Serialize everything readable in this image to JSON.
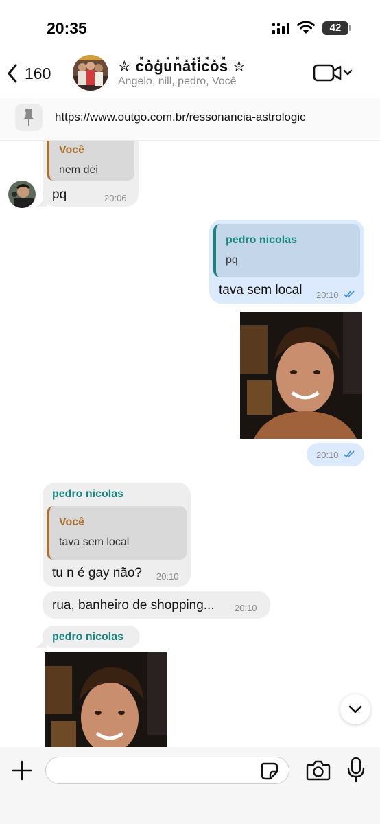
{
  "status_bar": {
    "time": "20:35",
    "battery": "42"
  },
  "header": {
    "back_count": "160",
    "group_title": "✮ c̽o̽g̽u̽n̽a̽t̽i̽c̽o̽s̽ ✮",
    "members": "Angelo, nill, pedro, Você"
  },
  "pinned": {
    "link": "https://www.outgo.com.br/ressonancia-astrologic"
  },
  "messages": {
    "m1": {
      "quote_author": "Você",
      "quote_text": "nem dei",
      "text": "pq",
      "time": "20:06"
    },
    "m2": {
      "quote_author": "pedro nicolas",
      "quote_text": "pq",
      "text": "tava sem local",
      "time": "20:10"
    },
    "m3": {
      "time": "20:10"
    },
    "m4": {
      "sender": "pedro nicolas",
      "quote_author": "Você",
      "quote_text": "tava sem local",
      "text": "tu n é gay não?",
      "time": "20:10"
    },
    "m5": {
      "text": "rua, banheiro de shopping...",
      "time": "20:10"
    },
    "m6": {
      "sender": "pedro nicolas"
    }
  },
  "composer": {
    "placeholder": ""
  },
  "icons": {
    "back": "chevron-left-icon",
    "video": "video-camera-icon",
    "pin": "pin-icon",
    "scroll": "chevron-down-icon",
    "plus": "plus-icon",
    "sticker": "sticker-icon",
    "camera": "camera-icon",
    "mic": "microphone-icon"
  },
  "colors": {
    "outgoing_bubble": "#dbeafd",
    "incoming_bubble": "#eeeeee",
    "sender_name": "#1b857b",
    "self_quote": "#a86f33",
    "read_ticks": "#3b8ee8"
  }
}
